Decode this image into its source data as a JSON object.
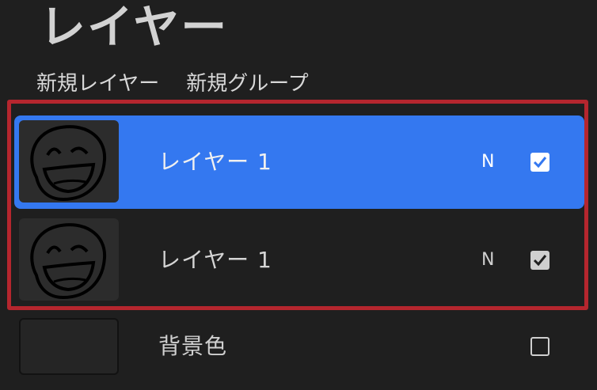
{
  "panel": {
    "title": "レイヤー",
    "new_layer_label": "新規レイヤー",
    "new_group_label": "新規グループ"
  },
  "layers": [
    {
      "name": "レイヤー 1",
      "blend_mode": "N",
      "visible": true,
      "selected": true,
      "thumbnail_icon": "smiley-sketch-icon"
    },
    {
      "name": "レイヤー 1",
      "blend_mode": "N",
      "visible": true,
      "selected": false,
      "thumbnail_icon": "smiley-sketch-icon"
    }
  ],
  "background": {
    "name": "背景色",
    "visible": false
  },
  "colors": {
    "panel_bg": "#1f1f1f",
    "selected_row": "#3478f0",
    "highlight_border": "#b5262e"
  }
}
